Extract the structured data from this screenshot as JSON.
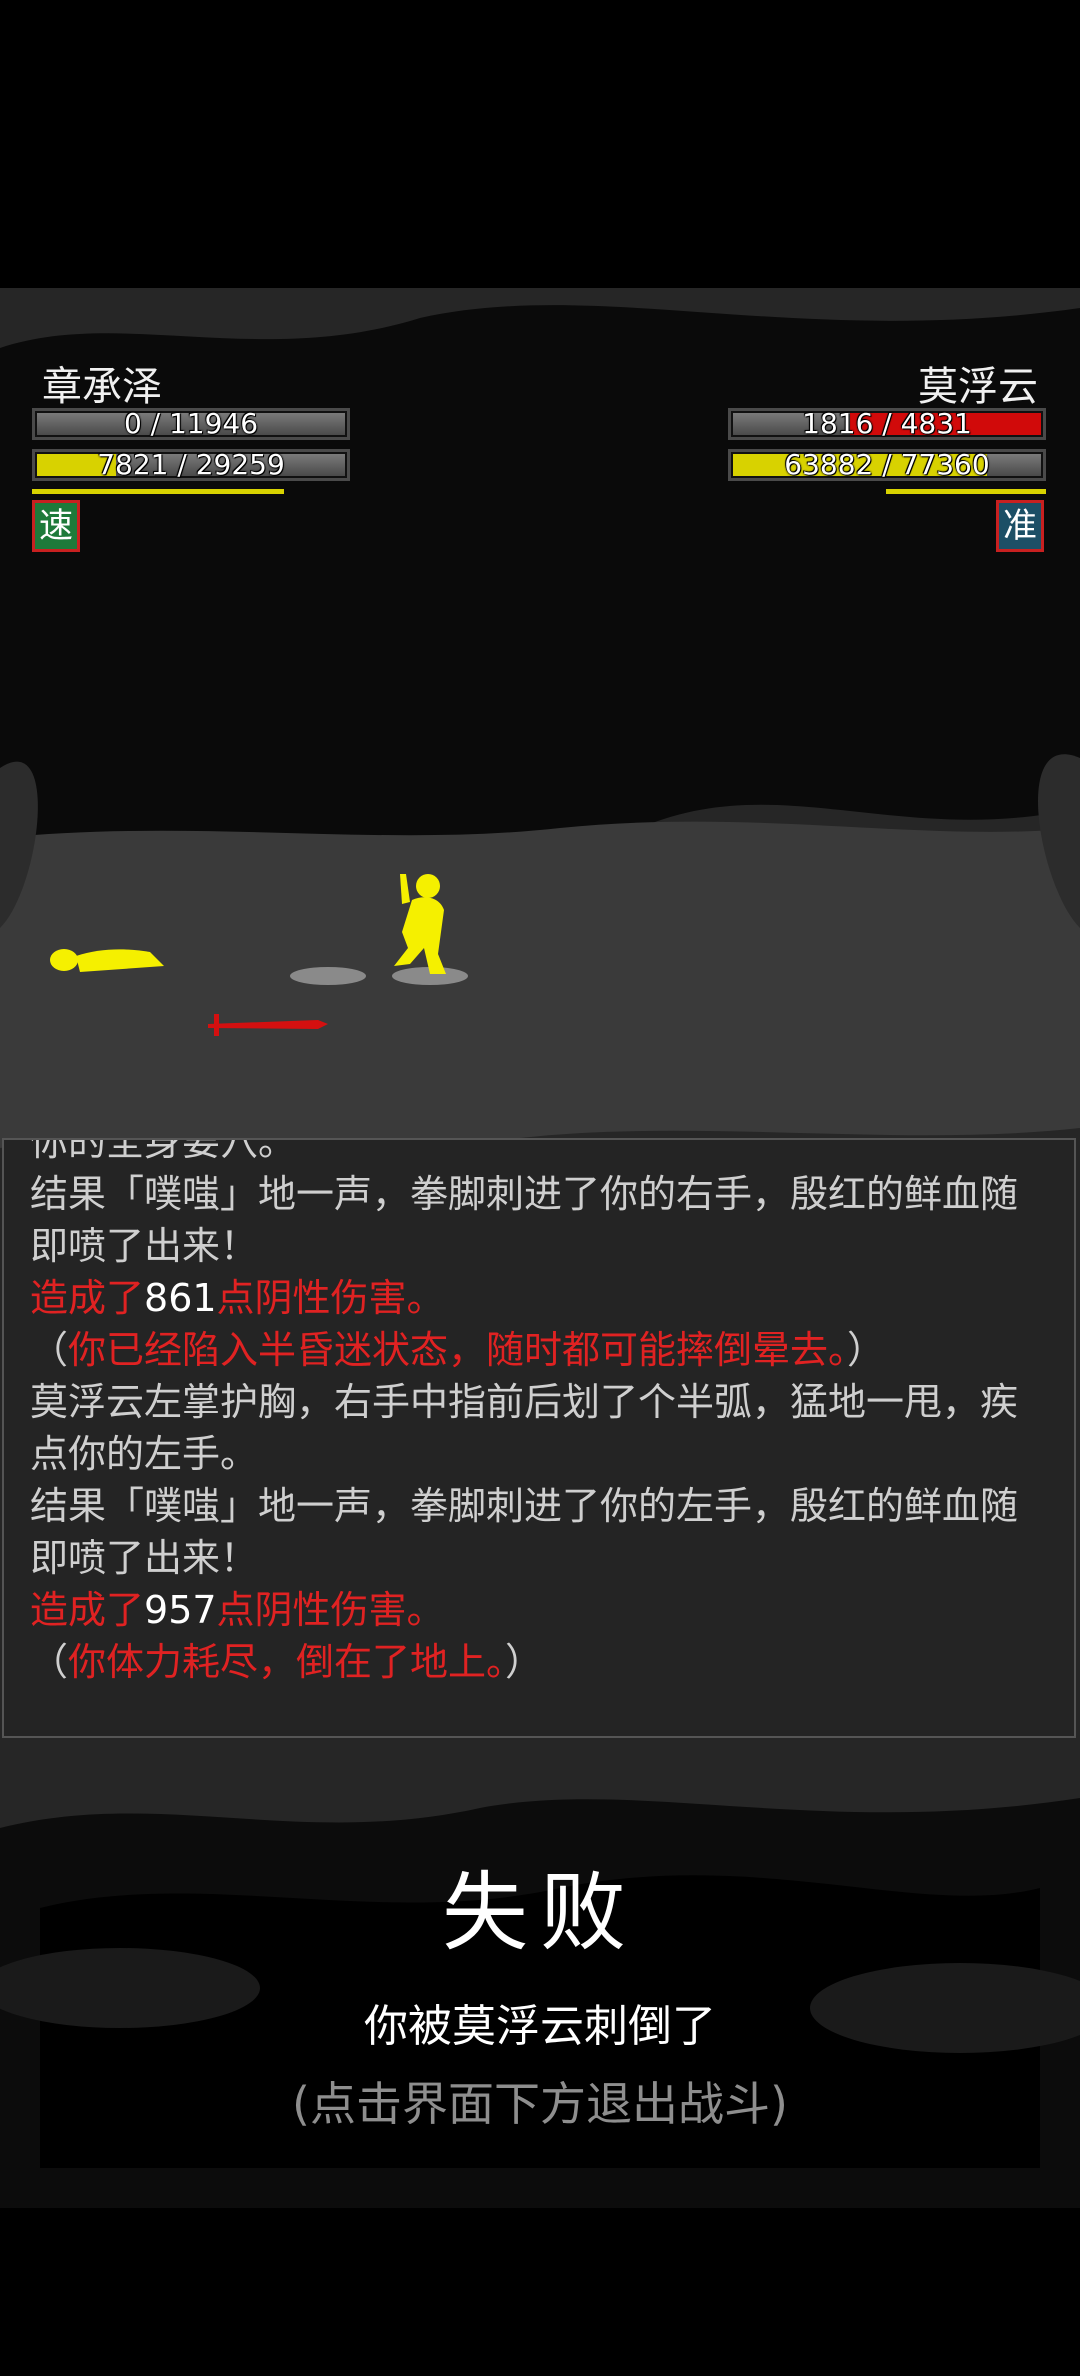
{
  "player": {
    "name": "章承泽",
    "hp": {
      "text": "0 / 11946",
      "fraction": 0.0
    },
    "inner": {
      "text": "7821 / 29259",
      "fraction": 0.267
    },
    "status_icon": "速",
    "status_color": "#1e7a3a"
  },
  "enemy": {
    "name": "莫浮云",
    "hp": {
      "text": "1816 / 4831",
      "fraction": 0.376
    },
    "inner": {
      "text": "63882 / 77360",
      "fraction": 0.826
    },
    "status_icon": "准",
    "status_color": "#1c4f66"
  },
  "colors": {
    "hp": "#d10a0a",
    "inner": "#d8d200",
    "figure": "#f5f000",
    "weapon": "#d41010"
  },
  "log": {
    "cut_line": "你的全身要穴。",
    "lines": [
      {
        "segments": [
          {
            "t": "结果「噗嗤」地一声，拳脚刺进了你的右手，殷红的鲜血随即喷了出来！",
            "c": ""
          }
        ]
      },
      {
        "segments": [
          {
            "t": "造成了",
            "c": "red"
          },
          {
            "t": "861",
            "c": "white"
          },
          {
            "t": "点阴性伤害。",
            "c": "red"
          }
        ]
      },
      {
        "segments": [
          {
            "t": "（",
            "c": ""
          },
          {
            "t": "你已经陷入半昏迷状态，随时都可能摔倒晕去。",
            "c": "red"
          },
          {
            "t": "）",
            "c": ""
          }
        ]
      },
      {
        "segments": [
          {
            "t": "莫浮云左掌护胸，右手中指前后划了个半弧，猛地一甩，疾点你的左手。",
            "c": ""
          }
        ]
      },
      {
        "segments": [
          {
            "t": "结果「噗嗤」地一声，拳脚刺进了你的左手，殷红的鲜血随即喷了出来！",
            "c": ""
          }
        ]
      },
      {
        "segments": [
          {
            "t": "造成了",
            "c": "red"
          },
          {
            "t": "957",
            "c": "white"
          },
          {
            "t": "点阴性伤害。",
            "c": "red"
          }
        ]
      },
      {
        "segments": [
          {
            "t": "（",
            "c": ""
          },
          {
            "t": "你体力耗尽，倒在了地上。",
            "c": "red"
          },
          {
            "t": "）",
            "c": ""
          }
        ]
      }
    ]
  },
  "result": {
    "title": "失败",
    "subtitle": "你被莫浮云刺倒了",
    "hint": "(点击界面下方退出战斗)"
  }
}
